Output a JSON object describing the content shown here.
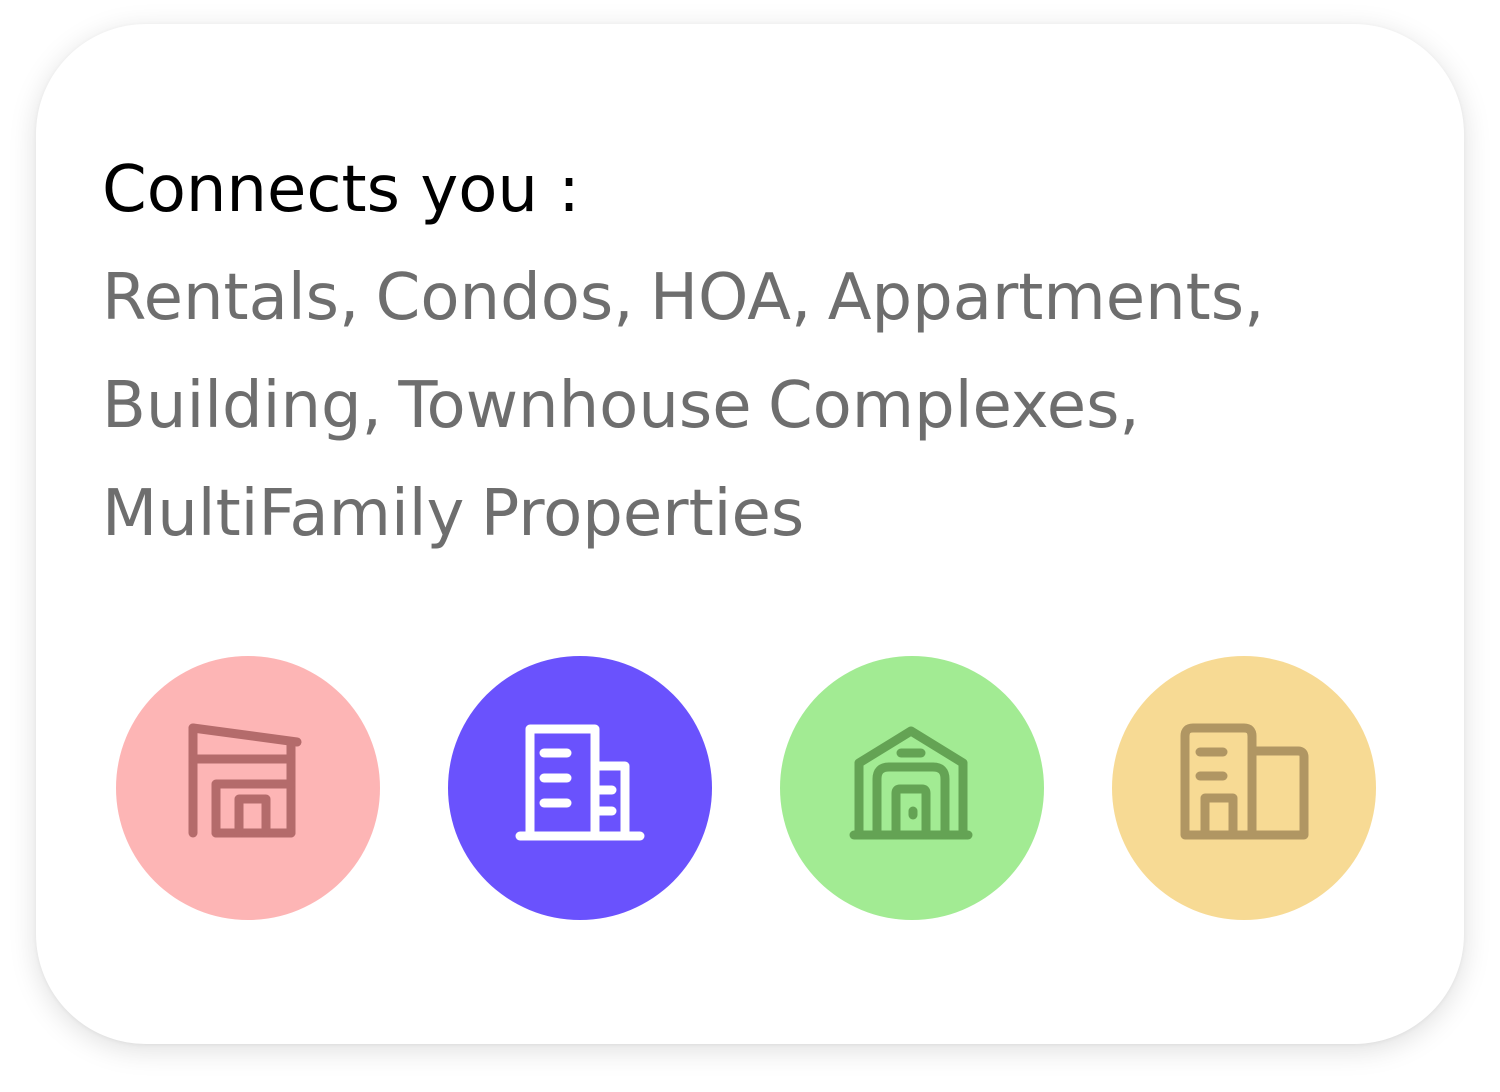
{
  "card": {
    "heading": "Connects you :",
    "description": "Rentals, Condos, HOA, Appartments, Building, Townhouse Complexes, MultiFamily Properties"
  },
  "icons": [
    {
      "name": "storefront-icon",
      "bg_color": "#fdb5b5",
      "stroke_color": "#b46b6b"
    },
    {
      "name": "apartment-building-icon",
      "bg_color": "#6a52fd",
      "stroke_color": "#ffffff"
    },
    {
      "name": "warehouse-icon",
      "bg_color": "#a2eb93",
      "stroke_color": "#64a354"
    },
    {
      "name": "office-building-icon",
      "bg_color": "#f7da94",
      "stroke_color": "#b09663"
    }
  ]
}
